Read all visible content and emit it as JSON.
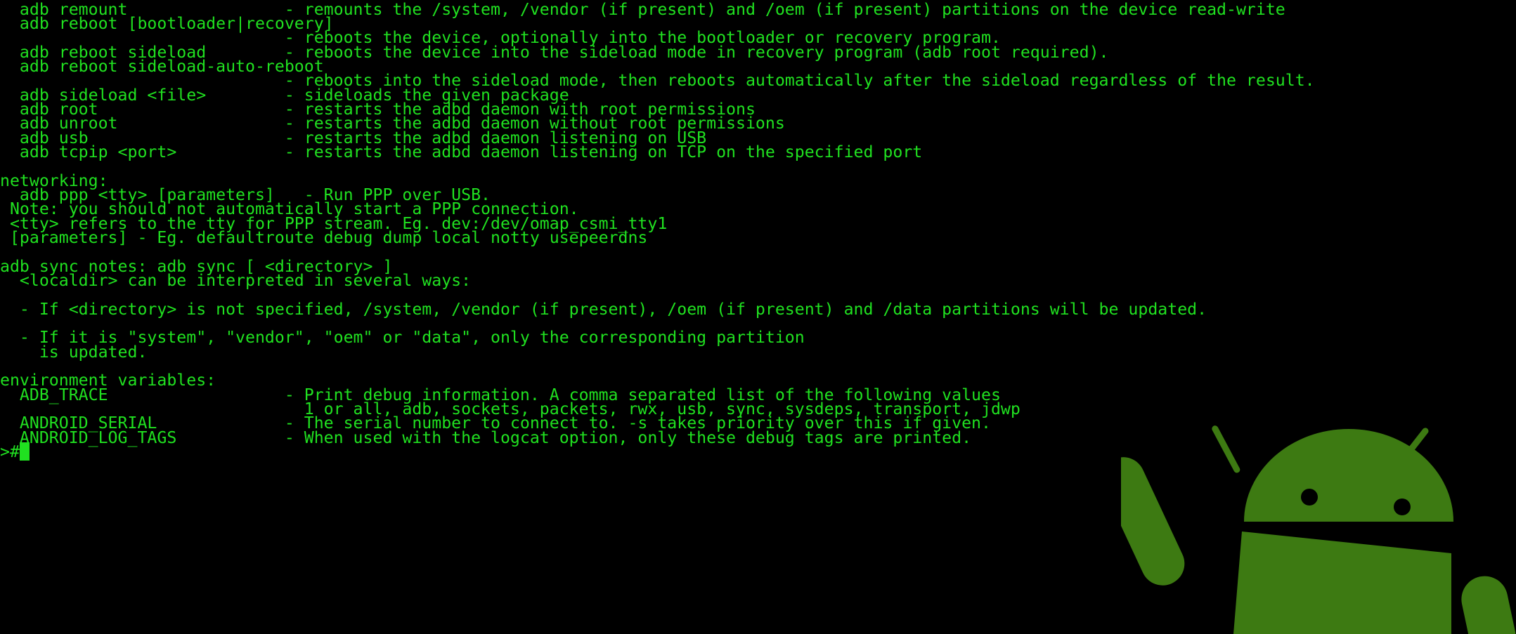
{
  "terminal": {
    "text_color": "#20e020",
    "background_color": "#000000",
    "lines": [
      "  adb remount                - remounts the /system, /vendor (if present) and /oem (if present) partitions on the device read-write",
      "  adb reboot [bootloader|recovery]",
      "                             - reboots the device, optionally into the bootloader or recovery program.",
      "  adb reboot sideload        - reboots the device into the sideload mode in recovery program (adb root required).",
      "  adb reboot sideload-auto-reboot",
      "                             - reboots into the sideload mode, then reboots automatically after the sideload regardless of the result.",
      "  adb sideload <file>        - sideloads the given package",
      "  adb root                   - restarts the adbd daemon with root permissions",
      "  adb unroot                 - restarts the adbd daemon without root permissions",
      "  adb usb                    - restarts the adbd daemon listening on USB",
      "  adb tcpip <port>           - restarts the adbd daemon listening on TCP on the specified port",
      "",
      "networking:",
      "  adb ppp <tty> [parameters]   - Run PPP over USB.",
      " Note: you should not automatically start a PPP connection.",
      " <tty> refers to the tty for PPP stream. Eg. dev:/dev/omap_csmi_tty1",
      " [parameters] - Eg. defaultroute debug dump local notty usepeerdns",
      "",
      "adb sync notes: adb sync [ <directory> ]",
      "  <localdir> can be interpreted in several ways:",
      "",
      "  - If <directory> is not specified, /system, /vendor (if present), /oem (if present) and /data partitions will be updated.",
      "",
      "  - If it is \"system\", \"vendor\", \"oem\" or \"data\", only the corresponding partition",
      "    is updated.",
      "",
      "environment variables:",
      "  ADB_TRACE                  - Print debug information. A comma separated list of the following values",
      "                               1 or all, adb, sockets, packets, rwx, usb, sync, sysdeps, transport, jdwp",
      "  ANDROID_SERIAL             - The serial number to connect to. -s takes priority over this if given.",
      "  ANDROID_LOG_TAGS           - When used with the logcat option, only these debug tags are printed."
    ],
    "prompt": ">#"
  },
  "mascot": {
    "icon": "android-robot-icon",
    "color": "#3d7a12",
    "eye_color": "#000000"
  }
}
